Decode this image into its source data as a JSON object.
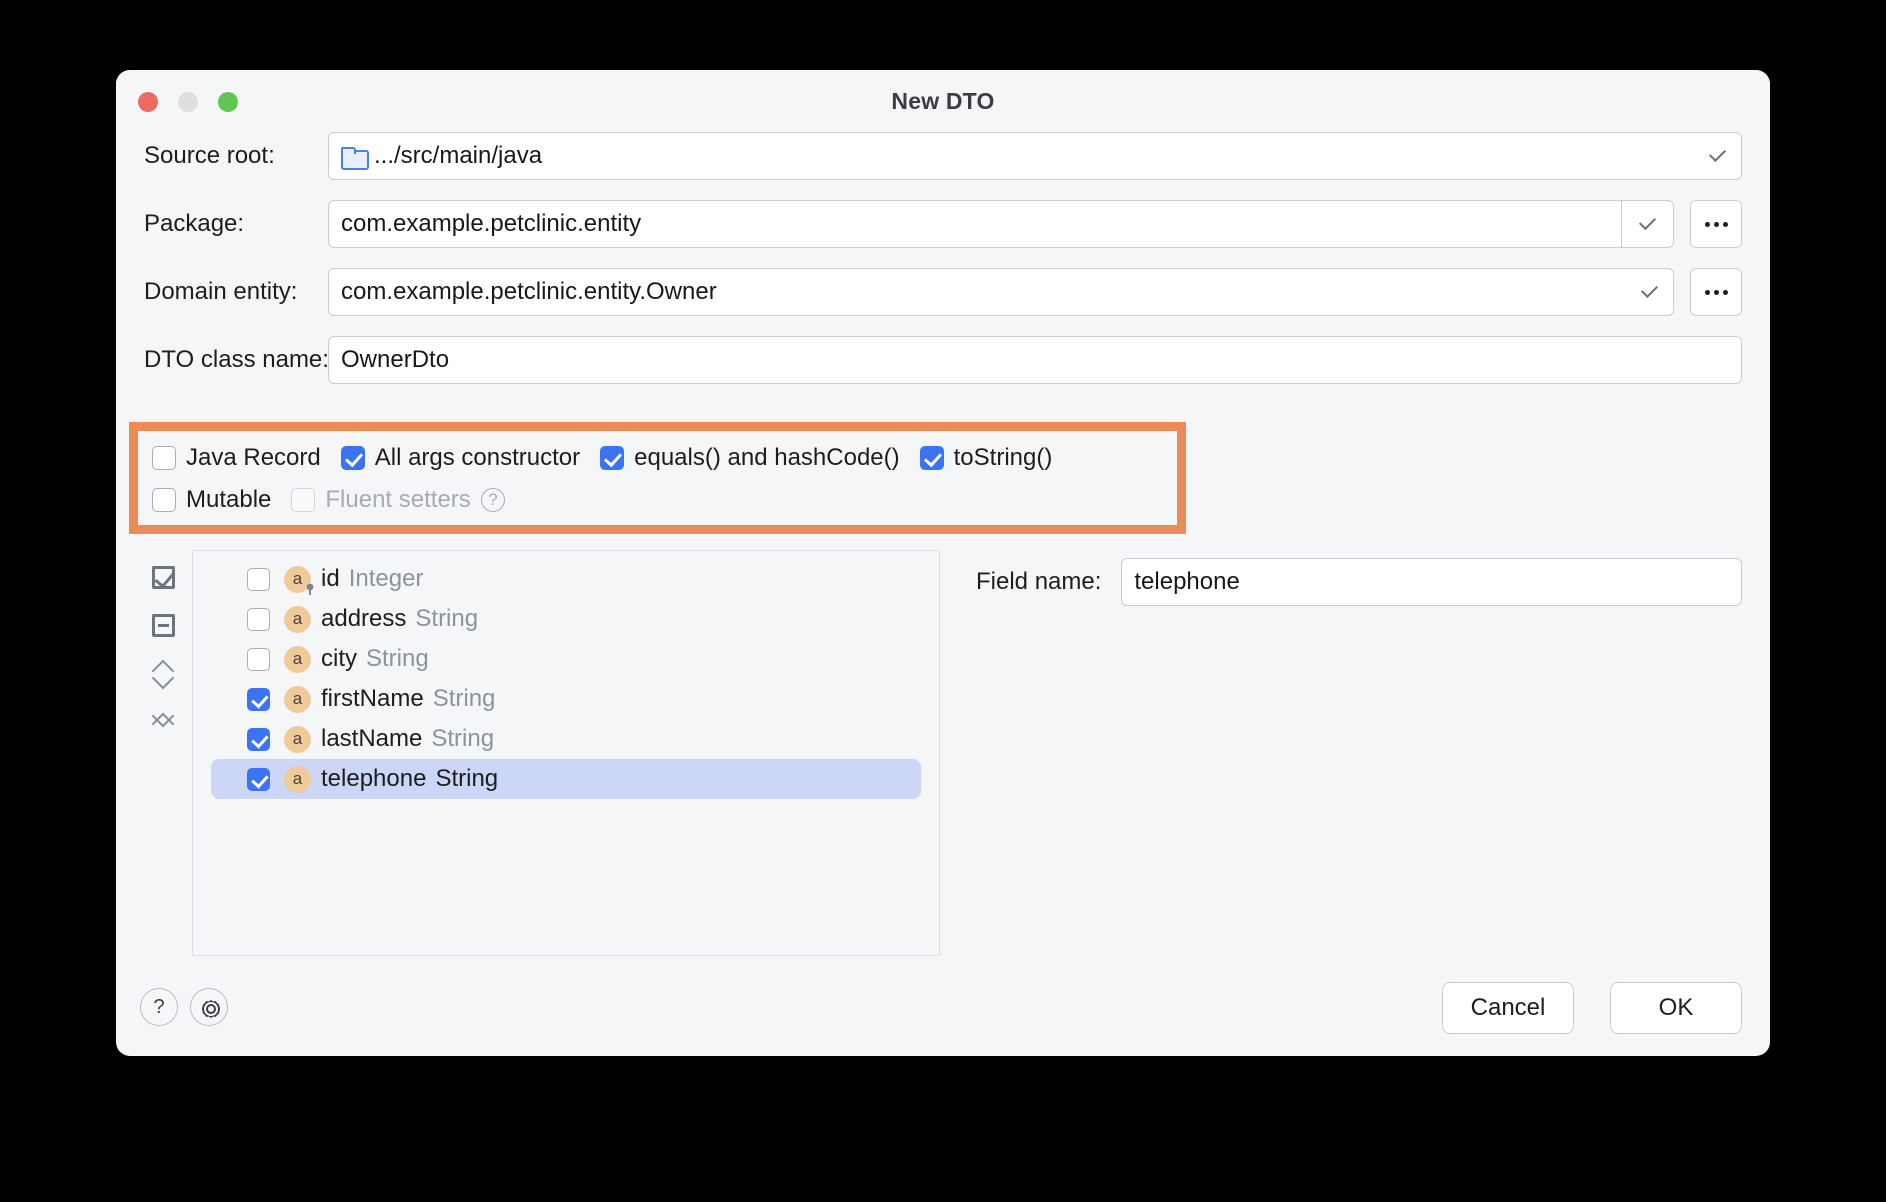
{
  "window": {
    "title": "New DTO",
    "traffic_lights": [
      "close-red",
      "minimize-yellow",
      "maximize-green"
    ]
  },
  "form": {
    "source_root": {
      "label": "Source root:",
      "value": ".../src/main/java",
      "icon": "folder-icon"
    },
    "package": {
      "label": "Package:",
      "value": "com.example.petclinic.entity",
      "browse_label": "..."
    },
    "domain_entity": {
      "label": "Domain entity:",
      "value": "com.example.petclinic.entity.Owner",
      "browse_label": "..."
    },
    "dto_class_name": {
      "label": "DTO class name:",
      "value": "OwnerDto"
    }
  },
  "options": {
    "highlight_color": "#ec8b55",
    "row1": [
      {
        "label": "Java Record",
        "checked": false,
        "disabled": false
      },
      {
        "label": "All args constructor",
        "checked": true,
        "disabled": false
      },
      {
        "label": "equals() and hashCode()",
        "checked": true,
        "disabled": false
      },
      {
        "label": "toString()",
        "checked": true,
        "disabled": false
      }
    ],
    "row2": [
      {
        "label": "Mutable",
        "checked": false,
        "disabled": false
      },
      {
        "label": "Fluent setters",
        "checked": false,
        "disabled": true
      }
    ],
    "help_glyph": "?"
  },
  "list_toolbar": [
    {
      "name": "select-all-icon"
    },
    {
      "name": "deselect-all-icon"
    },
    {
      "name": "expand-all-icon"
    },
    {
      "name": "collapse-all-icon"
    }
  ],
  "fields": [
    {
      "name": "id",
      "type": "Integer",
      "checked": false,
      "selected": false,
      "key": true
    },
    {
      "name": "address",
      "type": "String",
      "checked": false,
      "selected": false,
      "key": false
    },
    {
      "name": "city",
      "type": "String",
      "checked": false,
      "selected": false,
      "key": false
    },
    {
      "name": "firstName",
      "type": "String",
      "checked": true,
      "selected": false,
      "key": false
    },
    {
      "name": "lastName",
      "type": "String",
      "checked": true,
      "selected": false,
      "key": false
    },
    {
      "name": "telephone",
      "type": "String",
      "checked": true,
      "selected": true,
      "key": false
    }
  ],
  "field_badge_letter": "a",
  "detail": {
    "field_name_label": "Field name:",
    "field_name_value": "telephone"
  },
  "footer": {
    "help_label": "?",
    "cancel_label": "Cancel",
    "ok_label": "OK"
  },
  "colors": {
    "accent_blue": "#3a74f2",
    "highlight_orange": "#ec8b55",
    "selection_blue": "#ccd6f7",
    "badge_tan": "#efcb98"
  }
}
